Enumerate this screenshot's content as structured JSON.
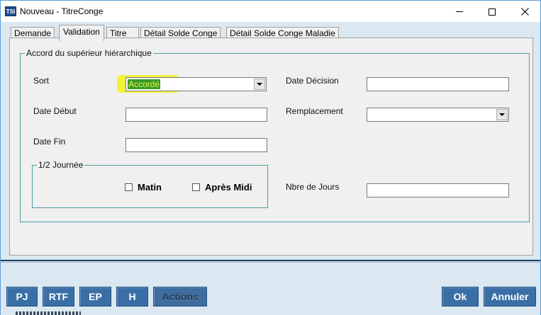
{
  "window": {
    "icon_text": "TSI",
    "title": "Nouveau - TitreConge"
  },
  "tabs": [
    {
      "label": "Demande",
      "active": false
    },
    {
      "label": "Validation",
      "active": true
    },
    {
      "label": "Titre",
      "active": false
    },
    {
      "label": "Détail Solde Conge",
      "active": false
    },
    {
      "label": "Détail Solde Conge Maladie",
      "active": false
    }
  ],
  "form": {
    "group_title": "Accord du supérieur hiérarchique",
    "sort_label": "Sort",
    "sort_value": "Accordé",
    "date_debut_label": "Date Début",
    "date_debut_value": "",
    "date_fin_label": "Date Fin",
    "date_fin_value": "",
    "date_decision_label": "Date Décision",
    "date_decision_value": "",
    "remplacement_label": "Remplacement",
    "remplacement_value": "",
    "half_day_title": "1/2 Journée",
    "matin_label": "Matin",
    "matin_checked": false,
    "apres_midi_label": "Après Midi",
    "apres_midi_checked": false,
    "nbre_jours_label": "Nbre de Jours",
    "nbre_jours_value": ""
  },
  "footer": {
    "pj": "PJ",
    "rtf": "RTF",
    "ep": "EP",
    "h": "H",
    "actions": "Actions",
    "ok": "Ok",
    "annuler": "Annuler"
  },
  "colors": {
    "client_bg": "#dbe8f2",
    "button_bg": "#3a6fa6",
    "highlight": "#f2f23a",
    "group_border": "#4c9da0"
  }
}
